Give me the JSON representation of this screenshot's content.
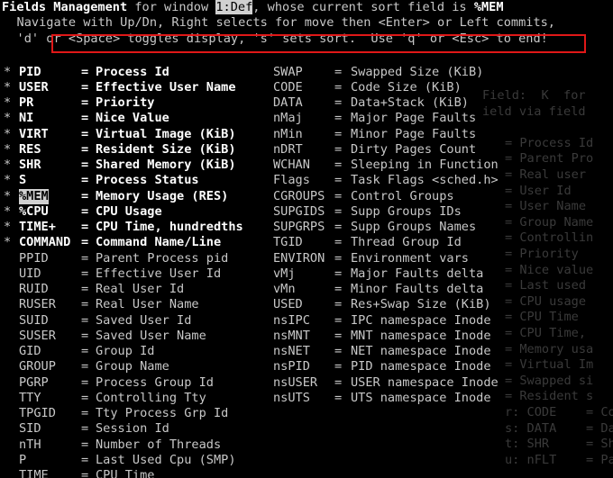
{
  "header": {
    "line1_title": "Fields Management",
    "line1_mid": " for window ",
    "line1_window": "1:Def",
    "line1_after": ", whose current sort field is ",
    "line1_sort": "%MEM",
    "line2": "   Navigate with Up/Dn, Right selects for move then <Enter> or Left commits,",
    "line3": "   'd' or <Space> toggles display, 's' sets sort.  Use 'q' or <Esc> to end!"
  },
  "left_fields": [
    {
      "mark": "*",
      "name": "PID",
      "desc": "Process Id",
      "on": true
    },
    {
      "mark": "*",
      "name": "USER",
      "desc": "Effective User Name",
      "on": true
    },
    {
      "mark": "*",
      "name": "PR",
      "desc": "Priority",
      "on": true
    },
    {
      "mark": "*",
      "name": "NI",
      "desc": "Nice Value",
      "on": true
    },
    {
      "mark": "*",
      "name": "VIRT",
      "desc": "Virtual Image (KiB)",
      "on": true
    },
    {
      "mark": "*",
      "name": "RES",
      "desc": "Resident Size (KiB)",
      "on": true
    },
    {
      "mark": "*",
      "name": "SHR",
      "desc": "Shared Memory (KiB)",
      "on": true
    },
    {
      "mark": "*",
      "name": "S",
      "desc": "Process Status",
      "on": true
    },
    {
      "mark": "*",
      "name": "%MEM",
      "desc": "Memory Usage (RES)",
      "on": true,
      "sel": true
    },
    {
      "mark": "*",
      "name": "%CPU",
      "desc": "CPU Usage",
      "on": true
    },
    {
      "mark": "*",
      "name": "TIME+",
      "desc": "CPU Time, hundredths",
      "on": true
    },
    {
      "mark": "*",
      "name": "COMMAND",
      "desc": "Command Name/Line",
      "on": true
    },
    {
      "mark": "",
      "name": "PPID",
      "desc": "Parent Process pid",
      "on": false
    },
    {
      "mark": "",
      "name": "UID",
      "desc": "Effective User Id",
      "on": false
    },
    {
      "mark": "",
      "name": "RUID",
      "desc": "Real User Id",
      "on": false
    },
    {
      "mark": "",
      "name": "RUSER",
      "desc": "Real User Name",
      "on": false
    },
    {
      "mark": "",
      "name": "SUID",
      "desc": "Saved User Id",
      "on": false
    },
    {
      "mark": "",
      "name": "SUSER",
      "desc": "Saved User Name",
      "on": false
    },
    {
      "mark": "",
      "name": "GID",
      "desc": "Group Id",
      "on": false
    },
    {
      "mark": "",
      "name": "GROUP",
      "desc": "Group Name",
      "on": false
    },
    {
      "mark": "",
      "name": "PGRP",
      "desc": "Process Group Id",
      "on": false
    },
    {
      "mark": "",
      "name": "TTY",
      "desc": "Controlling Tty",
      "on": false
    },
    {
      "mark": "",
      "name": "TPGID",
      "desc": "Tty Process Grp Id",
      "on": false
    },
    {
      "mark": "",
      "name": "SID",
      "desc": "Session Id",
      "on": false
    },
    {
      "mark": "",
      "name": "nTH",
      "desc": "Number of Threads",
      "on": false
    },
    {
      "mark": "",
      "name": "P",
      "desc": "Last Used Cpu (SMP)",
      "on": false
    },
    {
      "mark": "",
      "name": "TIME",
      "desc": "CPU Time",
      "on": false
    }
  ],
  "right_fields": [
    {
      "name": "SWAP",
      "desc": "Swapped Size (KiB)"
    },
    {
      "name": "CODE",
      "desc": "Code Size (KiB)"
    },
    {
      "name": "DATA",
      "desc": "Data+Stack (KiB)"
    },
    {
      "name": "nMaj",
      "desc": "Major Page Faults"
    },
    {
      "name": "nMin",
      "desc": "Minor Page Faults"
    },
    {
      "name": "nDRT",
      "desc": "Dirty Pages Count"
    },
    {
      "name": "WCHAN",
      "desc": "Sleeping in Function"
    },
    {
      "name": "Flags",
      "desc": "Task Flags <sched.h>"
    },
    {
      "name": "CGROUPS",
      "desc": "Control Groups"
    },
    {
      "name": "SUPGIDS",
      "desc": "Supp Groups IDs"
    },
    {
      "name": "SUPGRPS",
      "desc": "Supp Groups Names"
    },
    {
      "name": "TGID",
      "desc": "Thread Group Id"
    },
    {
      "name": "ENVIRON",
      "desc": "Environment vars"
    },
    {
      "name": "vMj",
      "desc": "Major Faults delta"
    },
    {
      "name": "vMn",
      "desc": "Minor Faults delta"
    },
    {
      "name": "USED",
      "desc": "Res+Swap Size (KiB)"
    },
    {
      "name": "nsIPC",
      "desc": "IPC namespace Inode"
    },
    {
      "name": "nsMNT",
      "desc": "MNT namespace Inode"
    },
    {
      "name": "nsNET",
      "desc": "NET namespace Inode"
    },
    {
      "name": "nsPID",
      "desc": "PID namespace Inode"
    },
    {
      "name": "nsUSER",
      "desc": "USER namespace Inode"
    },
    {
      "name": "nsUTS",
      "desc": "UTS namespace Inode"
    }
  ],
  "eq": "=",
  "ghost": [
    "Field:  K  for",
    "ield via field",
    "",
    "= Process Id",
    "= Parent Pro",
    "= Real user",
    "= User Id",
    "= User Name",
    "= Group Name",
    "= Controllin",
    "= Priority",
    "= Nice value",
    "= Last used",
    "= CPU usage",
    "= CPU Time",
    "= CPU Time,",
    "= Memory usa",
    "= Virtual Im",
    "= Swapped si",
    "= Resident s",
    "r: CODE    = Code size",
    "s: DATA    = Data+Stack",
    "t: SHR     = Shared Mem",
    "u: nFLT    = Page Fault"
  ]
}
